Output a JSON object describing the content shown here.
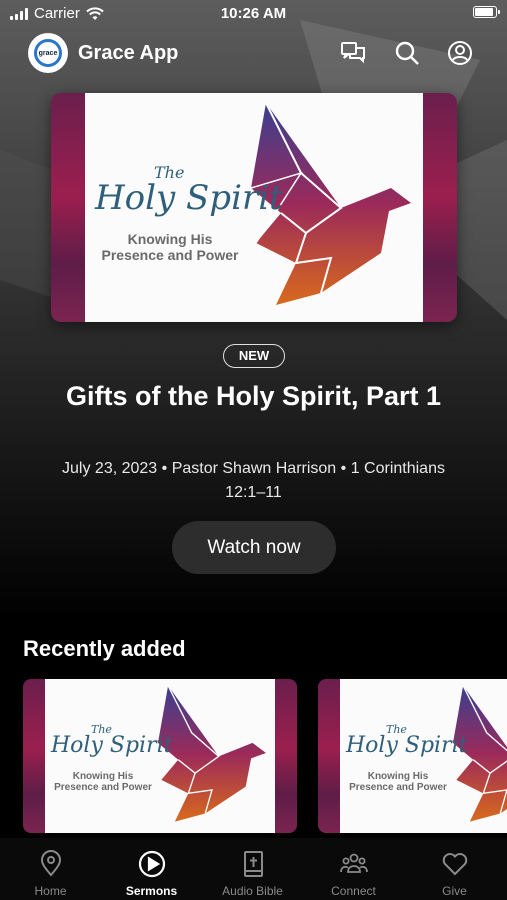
{
  "status_bar": {
    "carrier": "Carrier",
    "time": "10:26 AM",
    "battery_level": 0.9
  },
  "header": {
    "title": "Grace App",
    "logo_text": "grace",
    "icons": [
      "chat-icon",
      "search-icon",
      "profile-icon"
    ]
  },
  "featured": {
    "artwork": {
      "script_the": "The",
      "script_title": "Holy Spirit",
      "subtitle_line1": "Knowing His",
      "subtitle_line2": "Presence and Power"
    },
    "badge": "NEW",
    "title": "Gifts of the Holy Spirit, Part 1",
    "meta": "July 23, 2023 • Pastor Shawn Harrison • 1 Corinthians 12:1–11",
    "watch_label": "Watch now"
  },
  "recently_added": {
    "title": "Recently added",
    "items": [
      {
        "script_the": "The",
        "script_title": "Holy Spirit",
        "subtitle_line1": "Knowing His",
        "subtitle_line2": "Presence and Power"
      },
      {
        "script_the": "The",
        "script_title": "Holy Spirit",
        "subtitle_line1": "Knowing His",
        "subtitle_line2": "Presence and Power"
      }
    ]
  },
  "tabs": [
    {
      "label": "Home",
      "icon": "location-pin-icon",
      "active": false
    },
    {
      "label": "Sermons",
      "icon": "play-circle-icon",
      "active": true
    },
    {
      "label": "Audio Bible",
      "icon": "bible-icon",
      "active": false
    },
    {
      "label": "Connect",
      "icon": "people-icon",
      "active": false
    },
    {
      "label": "Give",
      "icon": "heart-icon",
      "active": false
    }
  ],
  "colors": {
    "accent_card_side": "#9b1f4e",
    "script_text": "#2f5f7a",
    "button_bg": "#2d2d2d"
  }
}
